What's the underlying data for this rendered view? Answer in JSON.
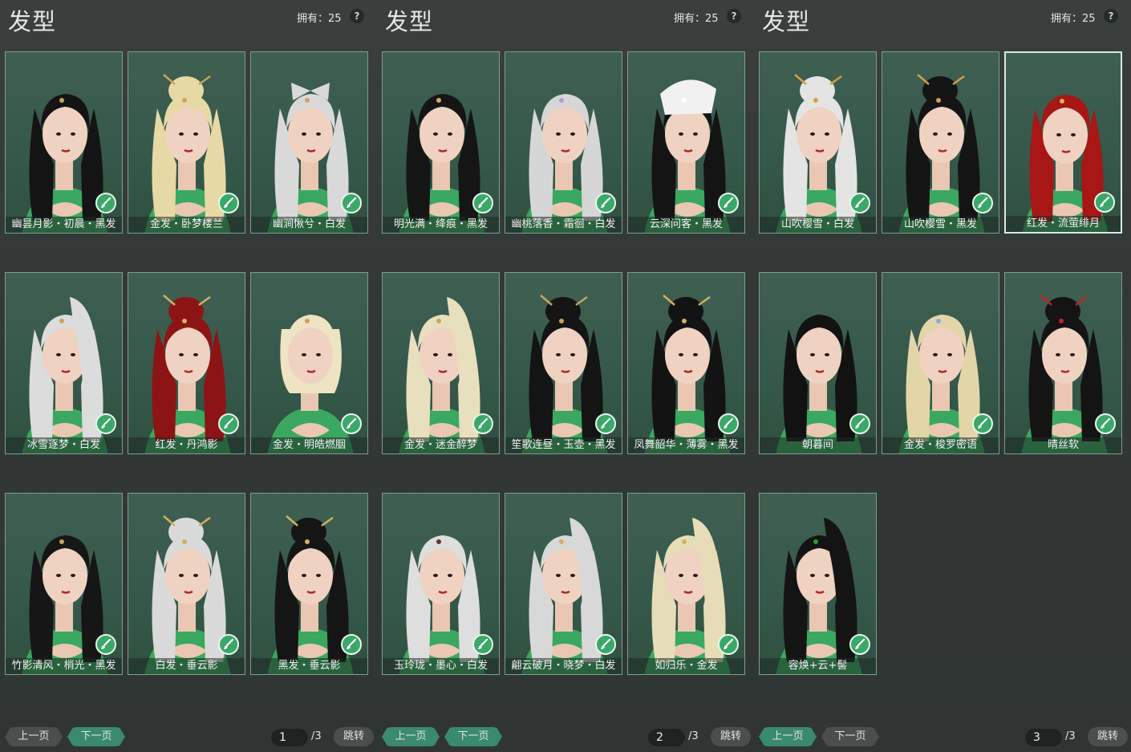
{
  "panels": [
    {
      "title": "发型",
      "owned": "拥有：25",
      "help": "?",
      "prev": "上一页",
      "next": "下一页",
      "page": "1",
      "total": "/3",
      "jump": "跳转",
      "active_btn": "next",
      "cards": [
        {
          "label": "幽昙月影・初晨・黑发",
          "hair": "#141414",
          "acc": "#c8a45a",
          "style": "long"
        },
        {
          "label": "金发・卧梦楼兰",
          "hair": "#e6d9a6",
          "acc": "#c8a45a",
          "style": "bun"
        },
        {
          "label": "幽涧愀兮・白发",
          "hair": "#d9d9d9",
          "acc": "#c8a45a",
          "style": "bow"
        },
        {
          "label": "冰雪逐梦・白发",
          "hair": "#dcdcdc",
          "acc": "#c8a45a",
          "style": "pony"
        },
        {
          "label": "红发・丹鸿影",
          "hair": "#8d1414",
          "acc": "#d4b060",
          "style": "bun"
        },
        {
          "label": "金发・明皓燃胭",
          "hair": "#eee3c2",
          "acc": "#c8a45a",
          "style": "short"
        },
        {
          "label": "竹影清风・梢光・黑发",
          "hair": "#161616",
          "acc": "#c8a45a",
          "style": "long"
        },
        {
          "label": "白发・垂云影",
          "hair": "#dadada",
          "acc": "#d4b060",
          "style": "bun"
        },
        {
          "label": "黑发・垂云影",
          "hair": "#151515",
          "acc": "#d4b060",
          "style": "bun"
        }
      ]
    },
    {
      "title": "发型",
      "owned": "拥有：25",
      "help": "?",
      "prev": "上一页",
      "next": "下一页",
      "page": "2",
      "total": "/3",
      "jump": "跳转",
      "active_btn": "both",
      "cards": [
        {
          "label": "明光满・绛痕・黑发",
          "hair": "#151515",
          "acc": "#d4b060",
          "style": "long"
        },
        {
          "label": "幽桃落香・霜徊・白发",
          "hair": "#d6d6d6",
          "acc": "#b89ad0",
          "style": "long"
        },
        {
          "label": "云深问客・黑发",
          "hair": "#141414",
          "acc": "#ffffff",
          "style": "hat"
        },
        {
          "label": "金发・迷金醉梦",
          "hair": "#e8dfbf",
          "acc": "#c8a45a",
          "style": "pony"
        },
        {
          "label": "笙歌连昼・玉壶・黑发",
          "hair": "#141414",
          "acc": "#c8a45a",
          "style": "bun"
        },
        {
          "label": "凤舞韶华・薄雾・黑发",
          "hair": "#131313",
          "acc": "#d4b060",
          "style": "bun"
        },
        {
          "label": "玉玲珑・墨心・白发",
          "hair": "#dedede",
          "acc": "#5a3a2a",
          "style": "long"
        },
        {
          "label": "翩云破月・晓梦・白发",
          "hair": "#d8d8d8",
          "acc": "#d4b060",
          "style": "pony"
        },
        {
          "label": "如归乐・金发",
          "hair": "#e6ddb8",
          "acc": "#d4b060",
          "style": "pony"
        }
      ]
    },
    {
      "title": "发型",
      "owned": "拥有：25",
      "help": "?",
      "prev": "上一页",
      "next": "下一页",
      "page": "3",
      "total": "/3",
      "jump": "跳转",
      "active_btn": "prev",
      "cards": [
        {
          "label": "山吹樱雪・白发",
          "hair": "#e4e4e4",
          "acc": "#d4a040",
          "style": "bun"
        },
        {
          "label": "山吹樱雪・黑发",
          "hair": "#141414",
          "acc": "#d4a040",
          "style": "bun"
        },
        {
          "label": "红发・流萤绯月",
          "hair": "#a81616",
          "acc": "#d4b060",
          "style": "long",
          "selected": true
        },
        {
          "label": "朝暮间",
          "hair": "#121212",
          "acc": "#121212",
          "style": "straight"
        },
        {
          "label": "金发・梭罗密语",
          "hair": "#e2d6a8",
          "acc": "#8aa8e8",
          "style": "long"
        },
        {
          "label": "晴丝软",
          "hair": "#141414",
          "acc": "#c02030",
          "style": "bun"
        },
        {
          "label": "容焕+云+髻",
          "hair": "#141414",
          "acc": "#2a9a3a",
          "style": "pony"
        }
      ]
    }
  ]
}
